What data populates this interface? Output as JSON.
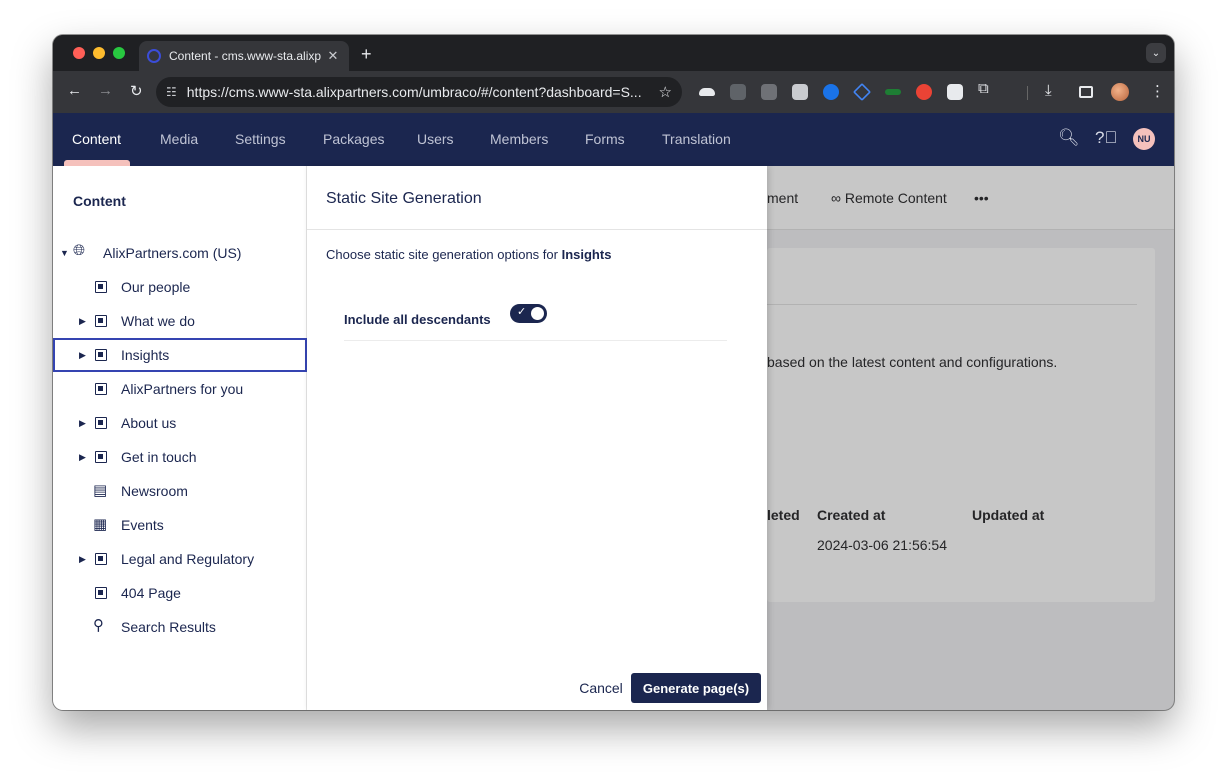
{
  "browser": {
    "tab_title": "Content - cms.www-sta.alixp",
    "url": "https://cms.www-sta.alixpartners.com/umbraco/#/content?dashboard=S...",
    "colors": {
      "frame": "#1f2023",
      "toolbar": "#35363a",
      "omnibox": "#202124"
    }
  },
  "header": {
    "nav": [
      "Content",
      "Media",
      "Settings",
      "Packages",
      "Users",
      "Members",
      "Forms",
      "Translation"
    ],
    "active": "Content",
    "user_initials": "NU",
    "colors": {
      "background": "#1b264f",
      "accent": "#f5c1bc"
    }
  },
  "tree": {
    "title": "Content",
    "root": {
      "label": "AlixPartners.com (US)",
      "icon": "globe-icon"
    },
    "items": [
      {
        "label": "Our people",
        "icon": "page-icon",
        "expandable": false
      },
      {
        "label": "What we do",
        "icon": "page-icon",
        "expandable": true
      },
      {
        "label": "Insights",
        "icon": "page-icon",
        "expandable": true,
        "selected": true
      },
      {
        "label": "AlixPartners for you",
        "icon": "page-icon",
        "expandable": false
      },
      {
        "label": "About us",
        "icon": "page-icon",
        "expandable": true
      },
      {
        "label": "Get in touch",
        "icon": "page-icon",
        "expandable": true
      },
      {
        "label": "Newsroom",
        "icon": "newsroom-icon",
        "expandable": false
      },
      {
        "label": "Events",
        "icon": "calendar-icon",
        "expandable": false
      },
      {
        "label": "Legal and Regulatory",
        "icon": "page-icon",
        "expandable": true
      },
      {
        "label": "404 Page",
        "icon": "page-icon",
        "expandable": false
      },
      {
        "label": "Search Results",
        "icon": "search-icon",
        "expandable": false
      }
    ]
  },
  "dashboard": {
    "tabs": [
      "ment",
      "∞ Remote Content",
      "•••"
    ],
    "description": "based on the latest content and configurations.",
    "columns": [
      "leted",
      "Created at",
      "Updated at"
    ],
    "rows": [
      {
        "created_at": "2024-03-06 21:56:54"
      }
    ]
  },
  "dialog": {
    "title": "Static Site Generation",
    "description_prefix": "Choose static site generation options for ",
    "description_target": "Insights",
    "toggle_label": "Include all descendants",
    "toggle_on": true,
    "cancel_label": "Cancel",
    "generate_label": "Generate page(s)"
  }
}
